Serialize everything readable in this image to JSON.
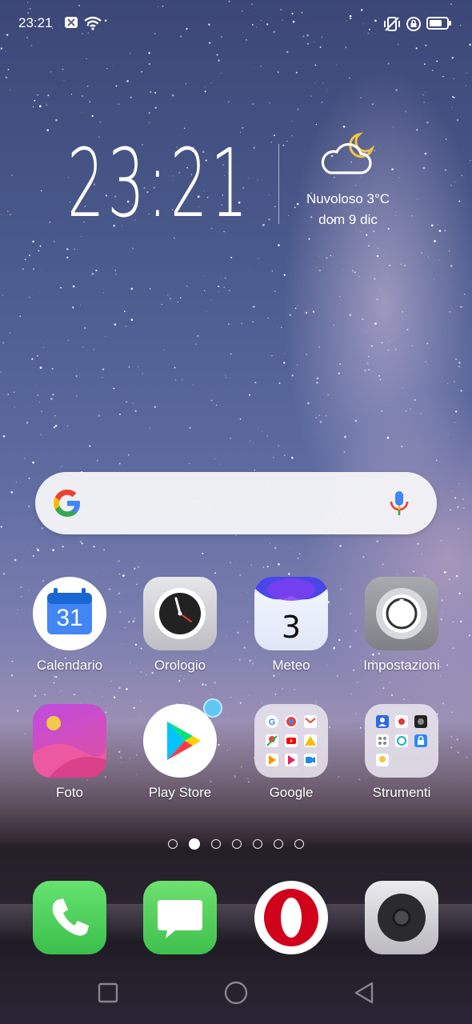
{
  "status_bar": {
    "time": "23:21"
  },
  "clock_widget": {
    "time": "23:21",
    "weather": "Nuvoloso 3°C",
    "date": "dom 9 dic"
  },
  "search_bar": {
    "logo": "google-g-logo",
    "mic": "mic-icon"
  },
  "apps": [
    {
      "label": "Calendario",
      "icon": "calendar-icon",
      "badge_text": "31"
    },
    {
      "label": "Orologio",
      "icon": "clock-icon"
    },
    {
      "label": "Meteo",
      "icon": "weather-icon",
      "badge_text": "3"
    },
    {
      "label": "Impostazioni",
      "icon": "settings-icon"
    },
    {
      "label": "Foto",
      "icon": "photos-icon"
    },
    {
      "label": "Play Store",
      "icon": "play-store-icon"
    },
    {
      "label": "Google",
      "icon": "folder-icon"
    },
    {
      "label": "Strumenti",
      "icon": "folder-icon"
    }
  ],
  "page_indicator": {
    "count": 7,
    "active_index": 1
  },
  "dock": [
    {
      "icon": "phone-icon"
    },
    {
      "icon": "messages-icon"
    },
    {
      "icon": "opera-icon"
    },
    {
      "icon": "camera-icon"
    }
  ],
  "colors": {
    "accent_blue": "#4285F4",
    "phone_green": "#4cd964",
    "opera_red": "#d1001b"
  }
}
